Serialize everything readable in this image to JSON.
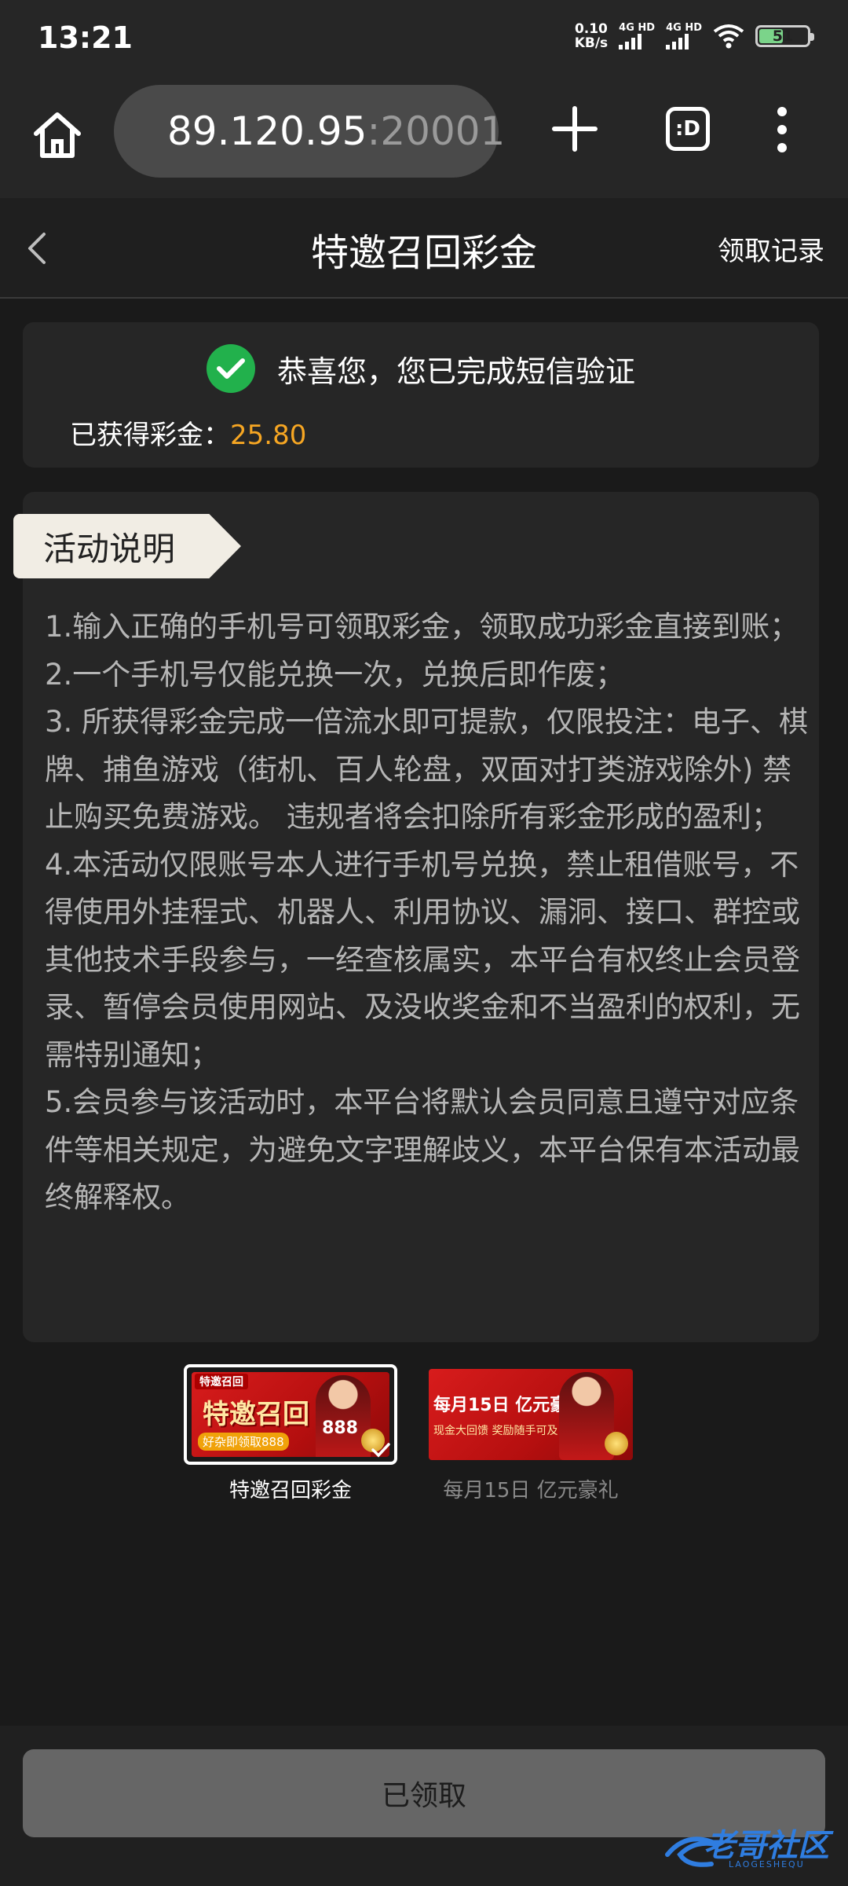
{
  "status_bar": {
    "time": "13:21",
    "net_speed_value": "0.10",
    "net_speed_unit": "KB/s",
    "sim1_label": "4G HD",
    "sim2_label": "4G HD",
    "battery_percent": "51",
    "icons": [
      "signal-icon",
      "signal-icon",
      "wifi-icon",
      "battery-icon"
    ]
  },
  "browser": {
    "url_host": "89.120.95",
    "url_port": ":20001",
    "tabs_label": ":D",
    "icons": [
      "home-icon",
      "lock-icon",
      "plus-icon",
      "tabs-icon",
      "more-icon"
    ]
  },
  "header": {
    "title": "特邀召回彩金",
    "right_link": "领取记录"
  },
  "success": {
    "message": "恭喜您，您已完成短信验证",
    "bonus_label": "已获得彩金：",
    "bonus_value": "25.80",
    "bonus_color": "#f6a623",
    "check_color": "#22b14c"
  },
  "activity": {
    "tag": "活动说明",
    "rules": [
      "1.输入正确的手机号可领取彩金，领取成功彩金直接到账；",
      "2.一个手机号仅能兑换一次，兑换后即作废；",
      "3. 所获得彩金完成一倍流水即可提款，仅限投注：电子、棋牌、捕鱼游戏（街机、百人轮盘，双面对打类游戏除外) 禁止购买免费游戏。 违规者将会扣除所有彩金形成的盈利；",
      "4.本活动仅限账号本人进行手机号兑换，禁止租借账号，不得使用外挂程式、机器人、利用协议、漏洞、接口、群控或其他技术手段参与，一经查核属实，本平台有权终止会员登录、暂停会员使用网站、及没收奖金和不当盈利的权利，无需特别通知；",
      "5.会员参与该活动时，本平台将默认会员同意且遵守对应条件等相关规定，为避免文字理解歧义，本平台保有本活动最终解释权。"
    ]
  },
  "banners": [
    {
      "label": "特邀召回彩金",
      "selected": true,
      "img_tag": "特邀召回",
      "img_title": "特邀召回",
      "img_sub": "好杂即领取888",
      "img_number": "888"
    },
    {
      "label": "每月15日 亿元豪礼",
      "selected": false,
      "img_title": "每月15日 亿元豪礼",
      "img_sub": "现金大回馈 奖励随手可及"
    }
  ],
  "claim_button": {
    "label": "已领取",
    "state": "disabled"
  },
  "watermark": {
    "text": "老哥社区",
    "sub": "LAOGESHEQU"
  }
}
